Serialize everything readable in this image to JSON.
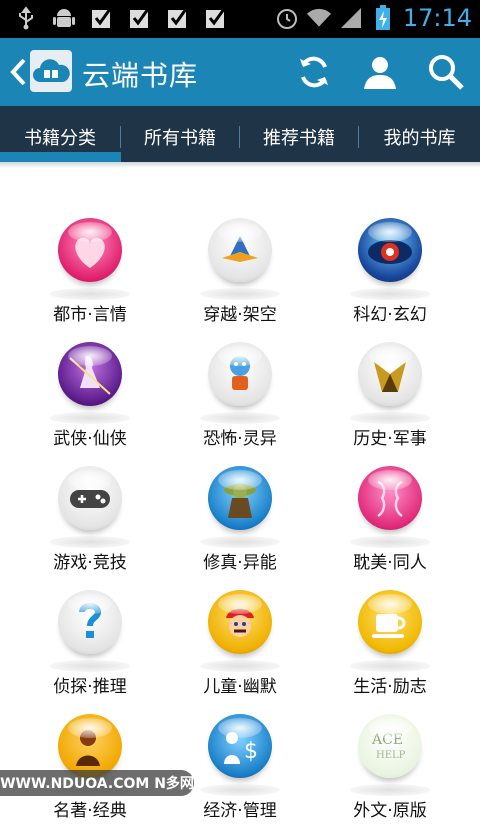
{
  "status_bar": {
    "time": "17:14",
    "left_icons": [
      "usb-icon",
      "android-debug-icon",
      "checkbox-icon",
      "checkbox-icon",
      "checkbox-icon",
      "checkbox-icon"
    ],
    "right_icons": [
      "alarm-icon",
      "wifi-icon",
      "signal-icon",
      "battery-charging-icon"
    ]
  },
  "app_bar": {
    "title": "云端书库",
    "accent": "#1b86b6",
    "actions": [
      "refresh-icon",
      "user-icon",
      "search-icon"
    ]
  },
  "tabs": [
    {
      "label": "书籍分类",
      "selected": true
    },
    {
      "label": "所有书籍",
      "selected": false
    },
    {
      "label": "推荐书籍",
      "selected": false
    },
    {
      "label": "我的书库",
      "selected": false
    }
  ],
  "categories": [
    {
      "label": "都市·言情",
      "icon": "heart-icon"
    },
    {
      "label": "穿越·架空",
      "icon": "spaceship-icon"
    },
    {
      "label": "科幻·玄幻",
      "icon": "eye-galaxy-icon"
    },
    {
      "label": "武侠·仙侠",
      "icon": "swordsman-icon"
    },
    {
      "label": "恐怖·灵异",
      "icon": "robot-icon"
    },
    {
      "label": "历史·军事",
      "icon": "golden-helmet-icon"
    },
    {
      "label": "游戏·竞技",
      "icon": "gamepad-icon"
    },
    {
      "label": "修真·异能",
      "icon": "yoda-icon"
    },
    {
      "label": "耽美·同人",
      "icon": "two-faces-icon"
    },
    {
      "label": "侦探·推理",
      "icon": "question-mark-icon"
    },
    {
      "label": "儿童·幽默",
      "icon": "mario-icon"
    },
    {
      "label": "生活·励志",
      "icon": "coffee-cup-icon"
    },
    {
      "label": "名著·经典",
      "icon": "classic-portrait-icon"
    },
    {
      "label": "经济·管理",
      "icon": "businessman-dollar-icon"
    },
    {
      "label": "外文·原版",
      "icon": "ace-text-icon"
    }
  ],
  "watermark": "WWW.NDUOA.COM N多网"
}
